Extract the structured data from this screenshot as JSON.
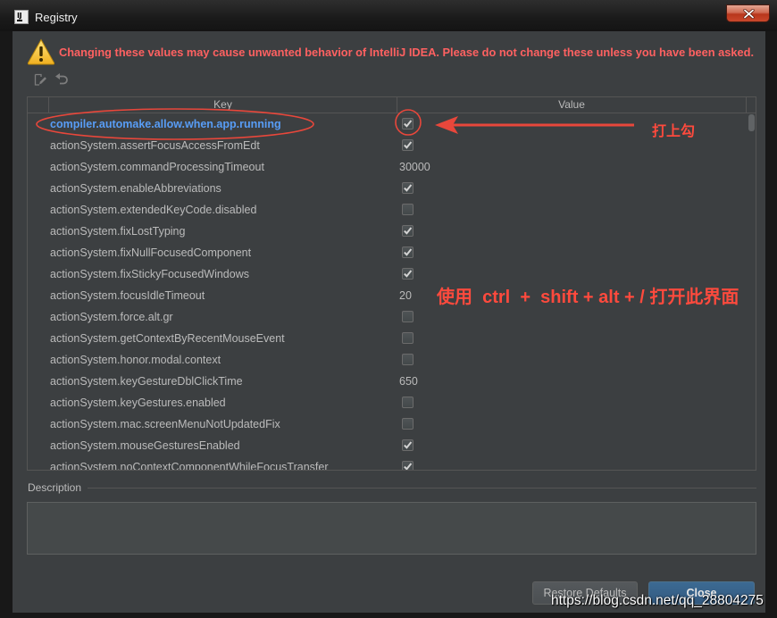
{
  "window": {
    "title": "Registry",
    "app_icon": "intellij-icon",
    "app_icon_label": "IJ",
    "close_icon": "close-icon"
  },
  "warning": {
    "icon": "warning-icon",
    "text": "Changing these values may cause unwanted behavior of IntelliJ IDEA. Please do not change these unless you have been asked."
  },
  "toolbar": {
    "items": [
      {
        "icon": "edit-icon",
        "enabled": false
      },
      {
        "icon": "revert-icon",
        "enabled": false
      }
    ]
  },
  "table": {
    "columns": [
      "Key",
      "Value"
    ],
    "scrollbar": {
      "position": 0
    },
    "rows": [
      {
        "key": "compiler.automake.allow.when.app.running",
        "type": "checkbox",
        "checked": true,
        "modified": true
      },
      {
        "key": "actionSystem.assertFocusAccessFromEdt",
        "type": "checkbox",
        "checked": true
      },
      {
        "key": "actionSystem.commandProcessingTimeout",
        "type": "text",
        "value": "30000"
      },
      {
        "key": "actionSystem.enableAbbreviations",
        "type": "checkbox",
        "checked": true
      },
      {
        "key": "actionSystem.extendedKeyCode.disabled",
        "type": "checkbox",
        "checked": false
      },
      {
        "key": "actionSystem.fixLostTyping",
        "type": "checkbox",
        "checked": true
      },
      {
        "key": "actionSystem.fixNullFocusedComponent",
        "type": "checkbox",
        "checked": true
      },
      {
        "key": "actionSystem.fixStickyFocusedWindows",
        "type": "checkbox",
        "checked": true
      },
      {
        "key": "actionSystem.focusIdleTimeout",
        "type": "text",
        "value": "20"
      },
      {
        "key": "actionSystem.force.alt.gr",
        "type": "checkbox",
        "checked": false
      },
      {
        "key": "actionSystem.getContextByRecentMouseEvent",
        "type": "checkbox",
        "checked": false
      },
      {
        "key": "actionSystem.honor.modal.context",
        "type": "checkbox",
        "checked": false
      },
      {
        "key": "actionSystem.keyGestureDblClickTime",
        "type": "text",
        "value": "650"
      },
      {
        "key": "actionSystem.keyGestures.enabled",
        "type": "checkbox",
        "checked": false
      },
      {
        "key": "actionSystem.mac.screenMenuNotUpdatedFix",
        "type": "checkbox",
        "checked": false
      },
      {
        "key": "actionSystem.mouseGesturesEnabled",
        "type": "checkbox",
        "checked": true
      },
      {
        "key": "actionSystem.noContextComponentWhileFocusTransfer",
        "type": "checkbox",
        "checked": true
      }
    ]
  },
  "description": {
    "label": "Description",
    "text": ""
  },
  "buttons": {
    "restore_defaults": "Restore Defaults",
    "close": "Close"
  },
  "annotations": {
    "check_note": "打上勾",
    "shortcut_note": "使用  ctrl  +  shift + alt + / 打开此界面"
  },
  "watermark": "https://blog.csdn.net/qq_28804275",
  "colors": {
    "panel": "#3c3f41",
    "text": "#bbbbbb",
    "warning_text": "#ff6161",
    "modified_key": "#589df6",
    "annotation": "#e8473b",
    "annotation_text": "#ff4a3d",
    "default_button": "#365880",
    "window_close_button": "#c94a2f"
  }
}
